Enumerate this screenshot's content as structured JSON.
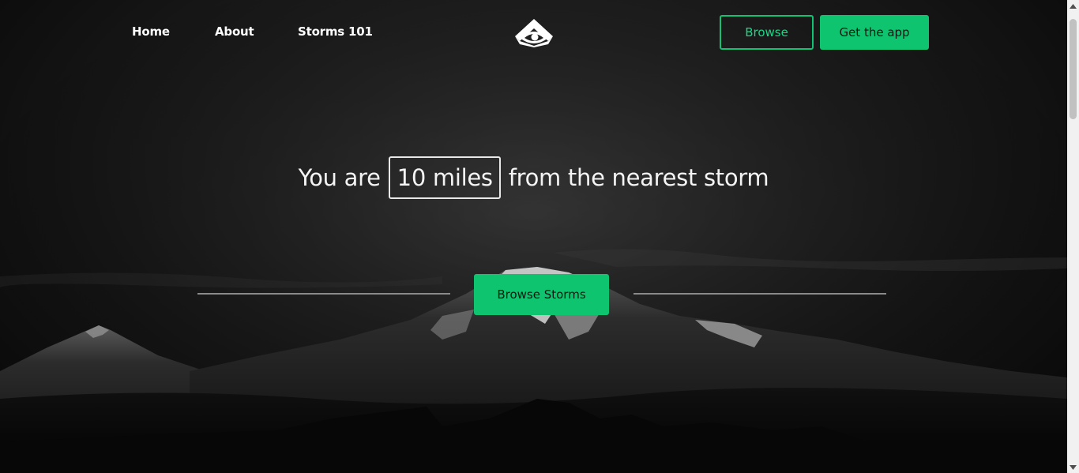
{
  "nav": {
    "links": [
      {
        "label": "Home"
      },
      {
        "label": "About"
      },
      {
        "label": "Storms 101"
      }
    ],
    "logo_icon": "eye-triangle-logo-icon",
    "browse_label": "Browse",
    "get_app_label": "Get the app"
  },
  "hero": {
    "prefix": "You are",
    "distance": "10 miles",
    "suffix": "from the nearest storm",
    "cta_label": "Browse Storms",
    "background_image": "dark monochrome mountain landscape"
  },
  "colors": {
    "accent": "#0ec46f",
    "accent_text": "#19d886",
    "background": "#1b1b1b",
    "text": "#ffffff"
  },
  "scrollbar": {
    "up_icon": "triangle-up-icon",
    "down_icon": "triangle-down-icon"
  }
}
